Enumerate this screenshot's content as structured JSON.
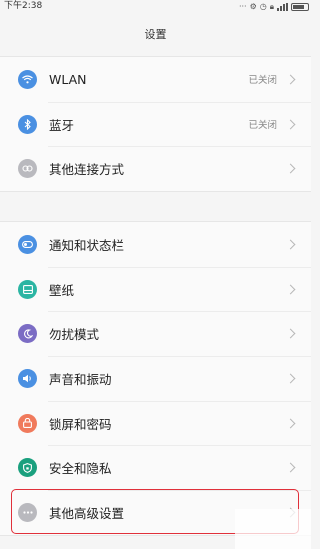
{
  "status_bar": {
    "time": "下午2:38",
    "icons": [
      "more-dots-icon",
      "alarm-icon",
      "clock-icon",
      "lock-icon",
      "signal-icon",
      "battery-icon"
    ]
  },
  "header": {
    "title": "设置"
  },
  "groups": [
    {
      "items": [
        {
          "label": "WLAN",
          "value": "已关闭",
          "icon": "wifi-icon",
          "color": "#4a90e2"
        },
        {
          "label": "蓝牙",
          "value": "已关闭",
          "icon": "bluetooth-icon",
          "color": "#4a90e2"
        },
        {
          "label": "其他连接方式",
          "value": "",
          "icon": "link-icon",
          "color": "#b9b9be"
        }
      ]
    },
    {
      "items": [
        {
          "label": "通知和状态栏",
          "value": "",
          "icon": "notification-icon",
          "color": "#4a90e2"
        },
        {
          "label": "壁纸",
          "value": "",
          "icon": "wallpaper-icon",
          "color": "#2bb5a3"
        },
        {
          "label": "勿扰模式",
          "value": "",
          "icon": "moon-icon",
          "color": "#7b6cc4"
        },
        {
          "label": "声音和振动",
          "value": "",
          "icon": "speaker-icon",
          "color": "#4a90e2"
        },
        {
          "label": "锁屏和密码",
          "value": "",
          "icon": "lock-icon",
          "color": "#f07a5c"
        },
        {
          "label": "安全和隐私",
          "value": "",
          "icon": "shield-icon",
          "color": "#1aa07e"
        },
        {
          "label": "其他高级设置",
          "value": "",
          "icon": "more-icon",
          "color": "#b9b9be"
        }
      ]
    }
  ],
  "highlight_color": "#e0303a"
}
